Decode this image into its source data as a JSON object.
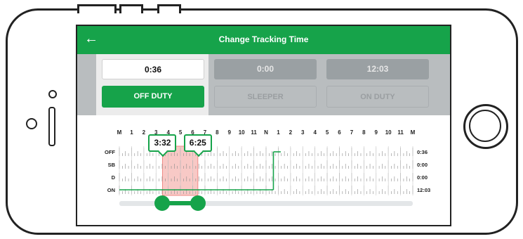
{
  "header": {
    "title": "Change Tracking Time",
    "back_icon": "arrow-left-icon"
  },
  "statuses": [
    {
      "time": "0:36",
      "label": "OFF DUTY",
      "active": true
    },
    {
      "time": "0:00",
      "label": "SLEEPER",
      "active": false
    },
    {
      "time": "12:03",
      "label": "ON DUTY",
      "active": false
    }
  ],
  "chart_data": {
    "type": "line",
    "hour_labels": [
      "M",
      "1",
      "2",
      "3",
      "4",
      "5",
      "6",
      "7",
      "8",
      "9",
      "10",
      "11",
      "N",
      "1",
      "2",
      "3",
      "4",
      "5",
      "6",
      "7",
      "8",
      "9",
      "10",
      "11",
      "M"
    ],
    "row_labels": [
      "OFF",
      "SB",
      "D",
      "ON"
    ],
    "row_totals": [
      "0:36",
      "0:00",
      "0:00",
      "12:03"
    ],
    "segments": [
      {
        "status": "ON",
        "from": 0,
        "to": 12.6
      },
      {
        "status": "OFF",
        "from": 12.6,
        "to": 13.2
      }
    ],
    "selection": {
      "start_label": "3:32",
      "end_label": "6:25",
      "start": 3.53,
      "end": 6.42
    },
    "colors": {
      "line": "#16a34a",
      "selection": "#f8c9c6",
      "selection_border": "#ef8a85"
    },
    "grid": true
  }
}
